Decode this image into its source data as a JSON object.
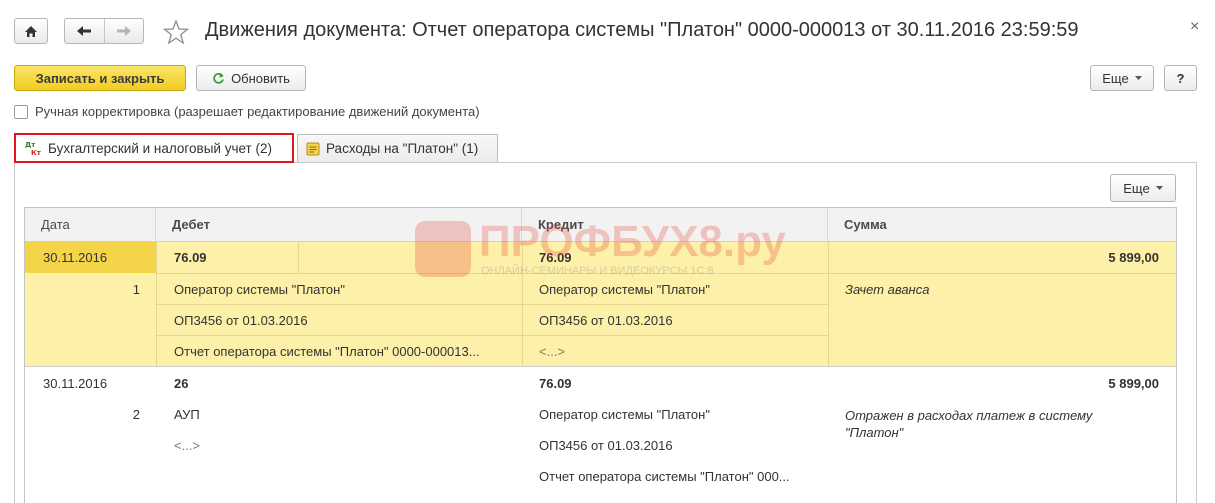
{
  "window": {
    "title": "Движения документа: Отчет оператора системы \"Платон\" 0000-000013 от 30.11.2016 23:59:59",
    "close_glyph": "×",
    "home_icon": "home-icon",
    "back_icon": "arrow-left-icon",
    "forward_icon": "arrow-right-icon",
    "favorite_icon": "star-icon"
  },
  "toolbar": {
    "save_close_label": "Записать и закрыть",
    "refresh_label": "Обновить",
    "more_label": "Еще",
    "help_label": "?"
  },
  "manual_edit": {
    "label": "Ручная корректировка (разрешает редактирование движений документа)",
    "checked": false
  },
  "tabs": [
    {
      "label": "Бухгалтерский и налоговый учет (2)",
      "icon": "dt-kt-icon",
      "active": true
    },
    {
      "label": "Расходы на \"Платон\" (1)",
      "icon": "register-icon",
      "active": false
    }
  ],
  "table": {
    "more_label": "Еще",
    "columns": [
      "Дата",
      "Дебет",
      "Кредит",
      "Сумма"
    ],
    "rows": [
      {
        "date": "30.11.2016",
        "num": "1",
        "debit_account": "76.09",
        "debit_lines": [
          "Оператор системы \"Платон\"",
          "ОП3456 от 01.03.2016",
          "Отчет оператора системы \"Платон\" 0000-000013..."
        ],
        "credit_account": "76.09",
        "credit_lines": [
          "Оператор системы \"Платон\"",
          "ОП3456 от 01.03.2016",
          "<...>"
        ],
        "amount": "5 899,00",
        "comment": "Зачет аванса",
        "selected": true
      },
      {
        "date": "30.11.2016",
        "num": "2",
        "debit_account": "26",
        "debit_lines": [
          "АУП",
          "<...>"
        ],
        "credit_account": "76.09",
        "credit_lines": [
          "Оператор системы \"Платон\"",
          "ОП3456 от 01.03.2016",
          "Отчет оператора системы \"Платон\" 000..."
        ],
        "amount": "5 899,00",
        "comment": "Отражен в расходах платеж в систему \"Платон\"",
        "selected": false
      }
    ]
  },
  "watermark": {
    "title": "ПРОФБУХ8.ру",
    "subtitle": "ОНЛАЙН-СЕМИНАРЫ И ВИДЕОКУРСЫ 1С:8"
  },
  "colors": {
    "accent_yellow": "#f4d54a",
    "selection_row": "#fdf0a8",
    "active_tab_border": "#e1141c"
  }
}
